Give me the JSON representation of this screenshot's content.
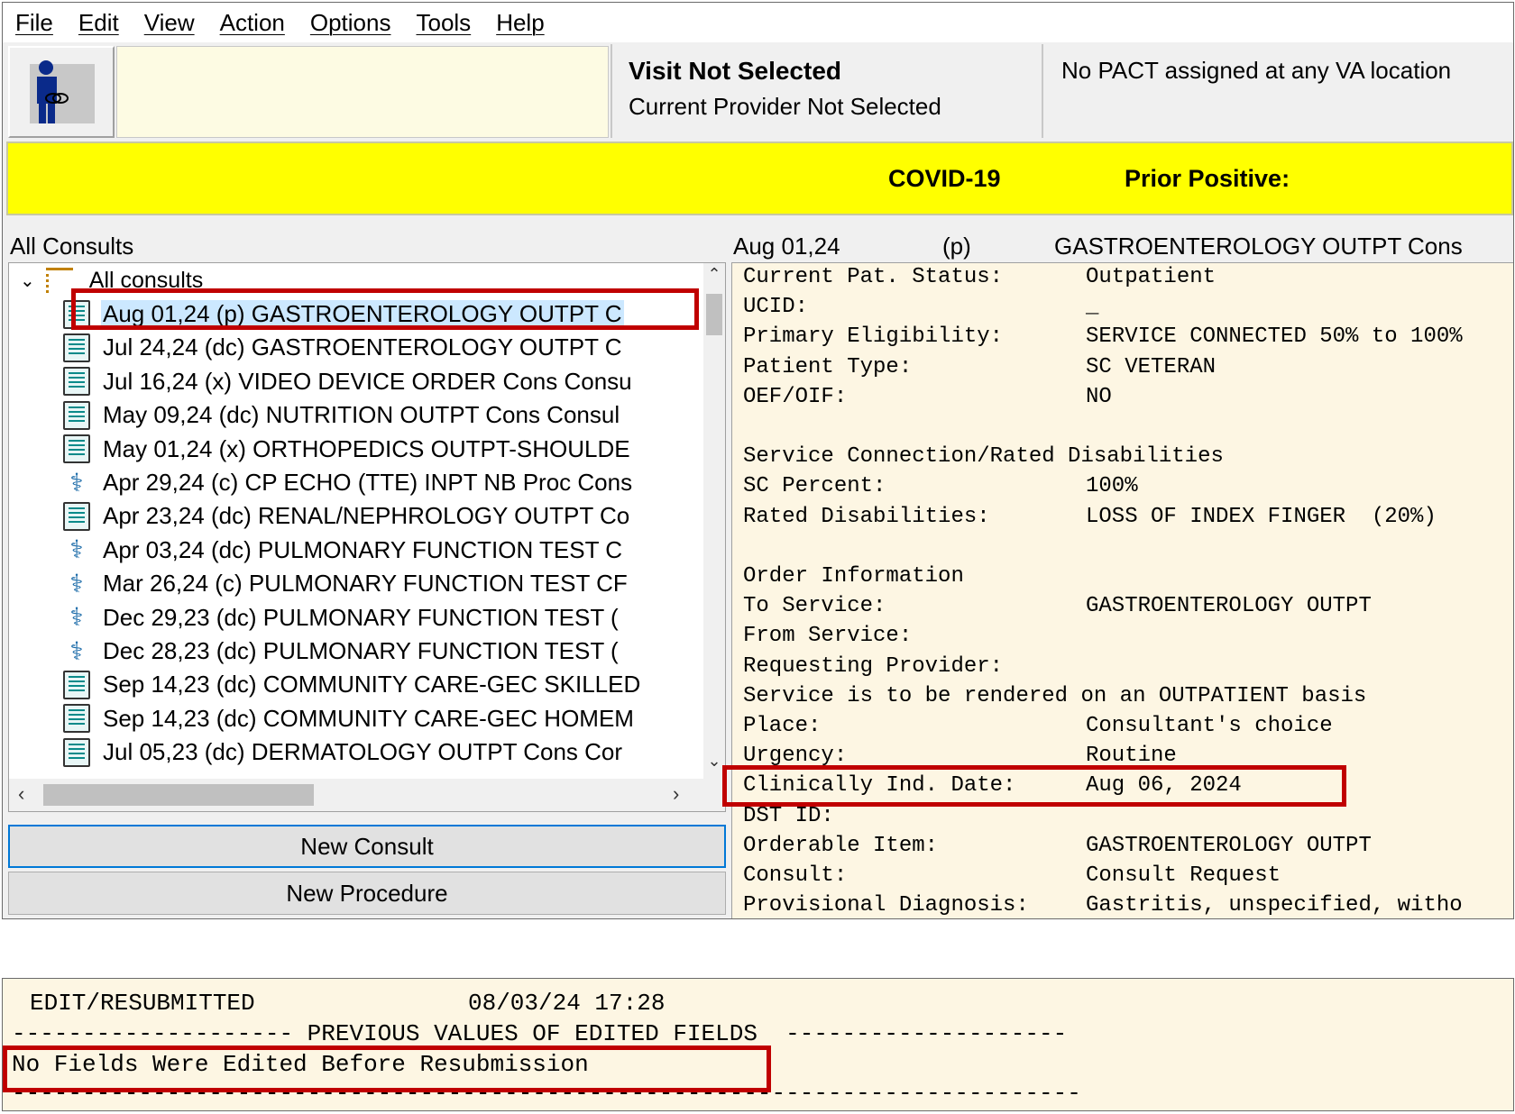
{
  "menu": [
    "File",
    "Edit",
    "View",
    "Action",
    "Options",
    "Tools",
    "Help"
  ],
  "header": {
    "visit_title": "Visit Not Selected",
    "visit_provider": "Current Provider Not Selected",
    "pact": "No PACT assigned at any VA location"
  },
  "banner": {
    "covid": "COVID-19",
    "prior": "Prior Positive:"
  },
  "left": {
    "title": "All Consults",
    "root": "All consults",
    "items": [
      {
        "text": "Aug 01,24  (p)  GASTROENTEROLOGY OUTPT C",
        "icon": "document-icon",
        "selected": true
      },
      {
        "text": "Jul 24,24  (dc)  GASTROENTEROLOGY OUTPT C",
        "icon": "document-icon"
      },
      {
        "text": "Jul 16,24  (x)  VIDEO DEVICE ORDER Cons Consu",
        "icon": "document-icon"
      },
      {
        "text": "May 09,24  (dc)  NUTRITION OUTPT Cons Consul",
        "icon": "document-icon"
      },
      {
        "text": "May 01,24  (x)  ORTHOPEDICS OUTPT-SHOULDE",
        "icon": "document-icon"
      },
      {
        "text": "Apr 29,24  (c)  CP ECHO (TTE) INPT NB Proc Cons",
        "icon": "caduceus-icon"
      },
      {
        "text": "Apr 23,24  (dc)  RENAL/NEPHROLOGY OUTPT Co",
        "icon": "document-icon"
      },
      {
        "text": "Apr 03,24  (dc)  PULMONARY FUNCTION TEST C",
        "icon": "caduceus-icon"
      },
      {
        "text": "Mar 26,24  (c)  PULMONARY FUNCTION TEST CF",
        "icon": "caduceus-icon"
      },
      {
        "text": "Dec 29,23  (dc)  PULMONARY FUNCTION TEST (",
        "icon": "caduceus-icon"
      },
      {
        "text": "Dec 28,23  (dc)  PULMONARY FUNCTION TEST (",
        "icon": "caduceus-icon"
      },
      {
        "text": "Sep 14,23  (dc)  COMMUNITY CARE-GEC SKILLED",
        "icon": "document-icon"
      },
      {
        "text": "Sep 14,23  (dc)  COMMUNITY CARE-GEC HOMEM",
        "icon": "document-icon"
      },
      {
        "text": "Jul 05,23  (dc)  DERMATOLOGY OUTPT Cons Cor",
        "icon": "document-icon"
      }
    ],
    "new_consult": "New Consult",
    "new_procedure": "New Procedure"
  },
  "detail": {
    "header_date": "Aug 01,24",
    "header_status": "(p)",
    "header_service": "GASTROENTEROLOGY OUTPT Cons",
    "lines": [
      {
        "label": "Current Pat. Status:",
        "value": "Outpatient"
      },
      {
        "label": "UCID:",
        "value": "_"
      },
      {
        "label": "Primary Eligibility:",
        "value": "SERVICE CONNECTED 50% to 100%"
      },
      {
        "label": "Patient Type:",
        "value": "SC VETERAN"
      },
      {
        "label": "OEF/OIF:",
        "value": "NO"
      },
      {
        "label": "",
        "value": ""
      },
      {
        "label": "Service Connection/Rated Disabilities",
        "value": ""
      },
      {
        "label": "SC Percent:",
        "value": "100%"
      },
      {
        "label": "Rated Disabilities:",
        "value": "LOSS OF INDEX FINGER  (20%)"
      },
      {
        "label": "",
        "value": ""
      },
      {
        "label": "Order Information",
        "value": ""
      },
      {
        "label": "To Service:",
        "value": "GASTROENTEROLOGY OUTPT"
      },
      {
        "label": "From Service:",
        "value": ""
      },
      {
        "label": "Requesting Provider:",
        "value": ""
      },
      {
        "label": "Service is to be rendered on an OUTPATIENT basis",
        "value": ""
      },
      {
        "label": "Place:",
        "value": "Consultant's choice"
      },
      {
        "label": "Urgency:",
        "value": "Routine"
      },
      {
        "label": "Clinically Ind. Date:",
        "value": "Aug 06, 2024"
      },
      {
        "label": "DST ID:",
        "value": ""
      },
      {
        "label": "Orderable Item:",
        "value": "GASTROENTEROLOGY OUTPT"
      },
      {
        "label": "Consult:",
        "value": "Consult Request"
      },
      {
        "label": "Provisional Diagnosis:",
        "value": "Gastritis, unspecified, witho"
      }
    ]
  },
  "bottom": {
    "line1_label": "EDIT/RESUBMITTED",
    "line1_time": "08/03/24 17:28",
    "line2": "-------------------- PREVIOUS VALUES OF EDITED FIELDS  --------------------",
    "line3": "No Fields Were Edited Before Resubmission",
    "line4": "----------------------------------------------------------------------------"
  }
}
